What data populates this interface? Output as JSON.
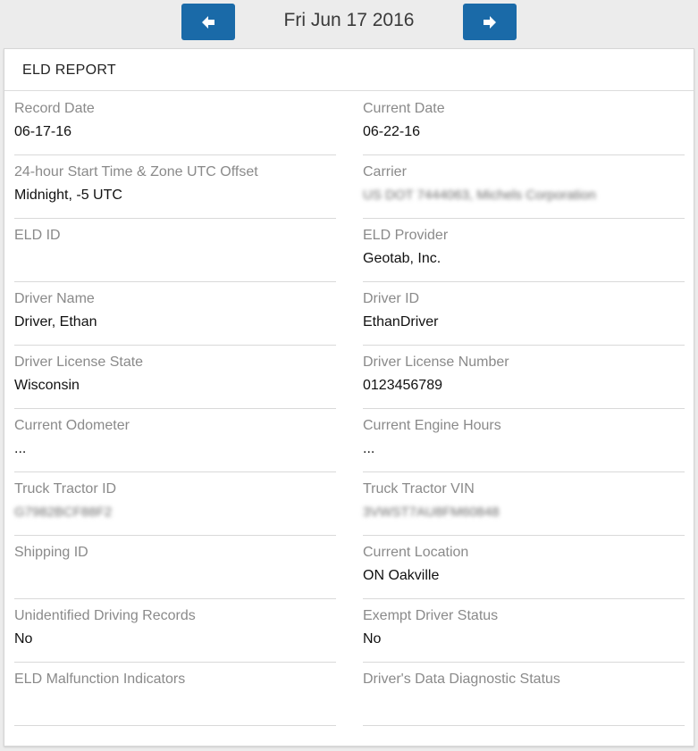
{
  "nav": {
    "date": "Fri Jun 17 2016",
    "prev_icon": "arrow-left-icon",
    "next_icon": "arrow-right-icon",
    "accent": "#1a6aa8"
  },
  "report": {
    "title": "ELD REPORT",
    "rows": [
      {
        "left": {
          "label": "Record Date",
          "value": "06-17-16"
        },
        "right": {
          "label": "Current Date",
          "value": "06-22-16"
        }
      },
      {
        "left": {
          "label": "24-hour Start Time & Zone UTC Offset",
          "value": "Midnight, -5 UTC"
        },
        "right": {
          "label": "Carrier",
          "value": "US DOT 7444063, Michels Corporation"
        }
      },
      {
        "left": {
          "label": "ELD ID",
          "value": ""
        },
        "right": {
          "label": "ELD Provider",
          "value": "Geotab, Inc."
        }
      },
      {
        "left": {
          "label": "Driver Name",
          "value": "Driver, Ethan"
        },
        "right": {
          "label": "Driver ID",
          "value": "EthanDriver"
        }
      },
      {
        "left": {
          "label": "Driver License State",
          "value": "Wisconsin"
        },
        "right": {
          "label": "Driver License Number",
          "value": "0123456789"
        }
      },
      {
        "left": {
          "label": "Current Odometer",
          "value": "..."
        },
        "right": {
          "label": "Current Engine Hours",
          "value": "..."
        }
      },
      {
        "left": {
          "label": "Truck Tractor ID",
          "value": "G7982BCF88F2"
        },
        "right": {
          "label": "Truck Tractor VIN",
          "value": "3VWST7AU8FM60848"
        }
      },
      {
        "left": {
          "label": "Shipping ID",
          "value": ""
        },
        "right": {
          "label": "Current Location",
          "value": "ON Oakville"
        }
      },
      {
        "left": {
          "label": "Unidentified Driving Records",
          "value": "No"
        },
        "right": {
          "label": "Exempt Driver Status",
          "value": "No"
        }
      },
      {
        "left": {
          "label": "ELD Malfunction Indicators",
          "value": ""
        },
        "right": {
          "label": "Driver's Data Diagnostic Status",
          "value": ""
        }
      }
    ]
  }
}
